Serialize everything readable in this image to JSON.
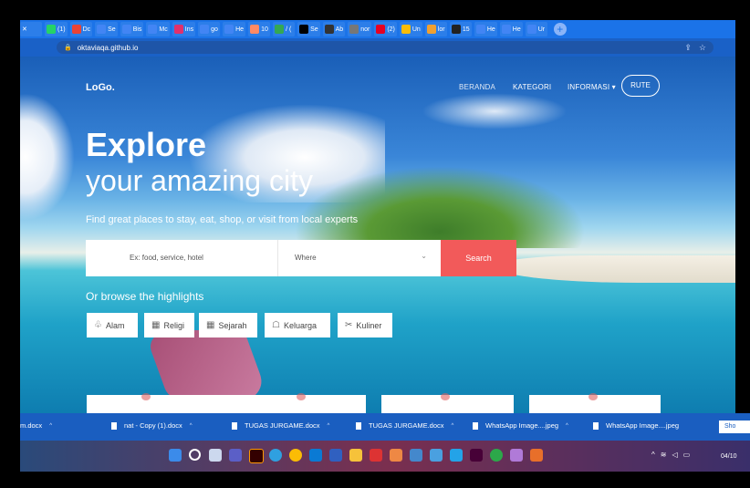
{
  "browser": {
    "tabs": [
      {
        "label": "(1)",
        "color": "#25d366"
      },
      {
        "label": "Dc",
        "color": "#ea4335"
      },
      {
        "label": "Se",
        "color": "#4285f4"
      },
      {
        "label": "Bis",
        "color": "#4285f4"
      },
      {
        "label": "Mc",
        "color": "#4285f4"
      },
      {
        "label": "Ins",
        "color": "#e1306c"
      },
      {
        "label": "go",
        "color": "#4285f4"
      },
      {
        "label": "He",
        "color": "#4285f4"
      },
      {
        "label": "10",
        "color": "#ff8a65"
      },
      {
        "label": "/ (",
        "color": "#34a853"
      },
      {
        "label": "Se",
        "color": "#000000"
      },
      {
        "label": "Ab",
        "color": "#333333"
      },
      {
        "label": "nor",
        "color": "#777777"
      },
      {
        "label": "(2)",
        "color": "#e60023"
      },
      {
        "label": "Un",
        "color": "#fbbc05"
      },
      {
        "label": "lor",
        "color": "#f0a030"
      },
      {
        "label": "15",
        "color": "#222222"
      },
      {
        "label": "He",
        "color": "#4285f4"
      },
      {
        "label": "He",
        "color": "#4285f4"
      },
      {
        "label": "Ur",
        "color": "#4285f4"
      }
    ],
    "new_tab_label": "+",
    "url": "oktaviaqa.github.io"
  },
  "page": {
    "logo": "LoGo.",
    "nav": {
      "beranda": "BERANDA",
      "kategori": "KATEGORI",
      "informasi": "INFORMASI ▾",
      "rute": "RUTE"
    },
    "hero_title": "Explore",
    "hero_subtitle": "your amazing city",
    "hero_description": "Find great places to stay, eat, shop, or visit from local experts",
    "search": {
      "what_placeholder": "Ex: food, service, hotel",
      "where_placeholder": "Where",
      "button": "Search"
    },
    "browse_label": "Or browse the highlights",
    "chips": [
      {
        "label": "Alam",
        "icon": "leaf-icon"
      },
      {
        "label": "Religi",
        "icon": "building-icon"
      },
      {
        "label": "Sejarah",
        "icon": "museum-icon"
      },
      {
        "label": "Keluarga",
        "icon": "family-icon"
      },
      {
        "label": "Kuliner",
        "icon": "utensils-icon"
      }
    ],
    "colors": {
      "accent": "#f25a5a",
      "nav_text": "#ffffff"
    }
  },
  "downloads": {
    "items": [
      "m.docx",
      "nat - Copy (1).docx",
      "TUGAS JURGAME.docx",
      "TUGAS JURGAME.docx",
      "WhatsApp Image....jpeg",
      "WhatsApp Image....jpeg"
    ],
    "show_all": "Sho"
  },
  "taskbar": {
    "clock": "04/10"
  }
}
